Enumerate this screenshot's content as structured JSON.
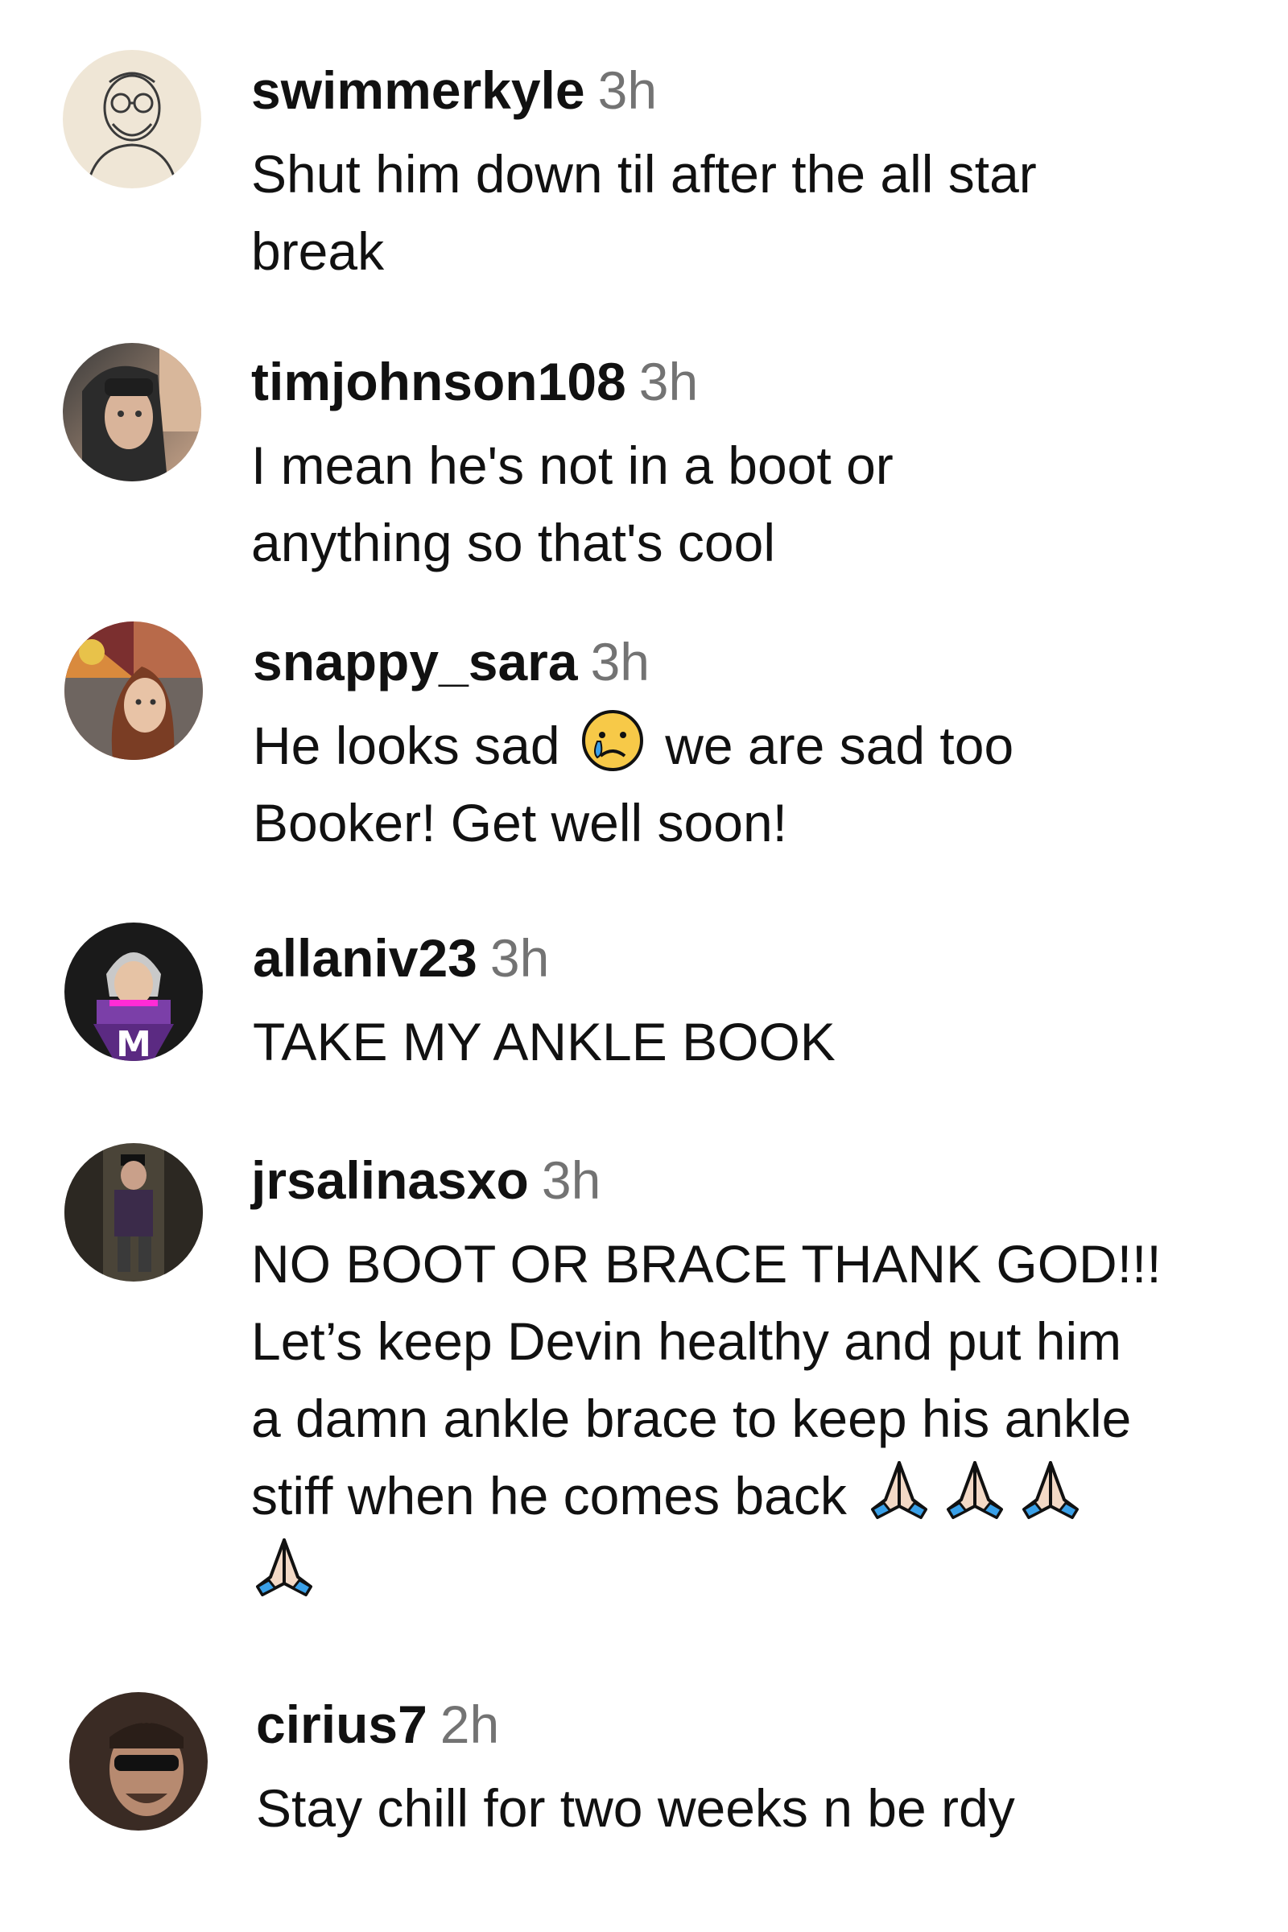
{
  "comments": [
    {
      "username": "swimmerkyle",
      "time": "3h",
      "text": "Shut him down til after the all star\nbreak",
      "avatar_icon": "sketch-avatar-icon"
    },
    {
      "username": "timjohnson108",
      "time": "3h",
      "text": "I mean he's not in a boot or\nanything so that's cool",
      "avatar_icon": "photo-avatar-icon"
    },
    {
      "username": "snappy_sara",
      "time": "3h",
      "text_before_emoji": "He looks sad",
      "emoji": "crying-face-emoji",
      "text_after_emoji": "we are sad too",
      "text_line2": "Booker! Get well soon!",
      "avatar_icon": "photo-avatar-icon"
    },
    {
      "username": "allaniv23",
      "time": "3h",
      "text": "TAKE MY ANKLE BOOK",
      "avatar_icon": "cartoon-avatar-icon"
    },
    {
      "username": "jrsalinasxo",
      "time": "3h",
      "text": "NO BOOT OR BRACE THANK GOD!!!\nLet’s keep Devin healthy and put him\na damn ankle brace to keep his ankle\nstiff when he comes back",
      "emoji": "folded-hands-emoji",
      "emoji_count": 4,
      "avatar_icon": "photo-avatar-icon"
    },
    {
      "username": "cirius7",
      "time": "2h",
      "text": "Stay chill for two weeks n be rdy",
      "avatar_icon": "photo-avatar-icon"
    }
  ]
}
